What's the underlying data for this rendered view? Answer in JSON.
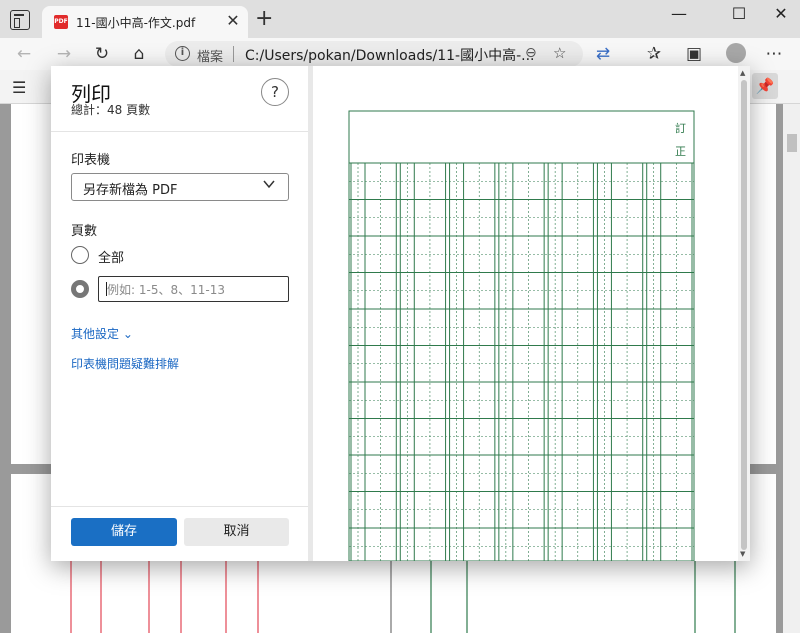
{
  "tab": {
    "title": "11-國小中高-作文.pdf",
    "icon_text": "PDF"
  },
  "window": {
    "minimize": "—",
    "maximize": "☐",
    "close": "✕"
  },
  "address": {
    "label": "檔案",
    "url": "C:/Users/pokan/Downloads/11-國小中高-..."
  },
  "dialog": {
    "title": "列印",
    "subtitle": "總計：48 頁數",
    "help": "?",
    "printer_label": "印表機",
    "printer_value": "另存新檔為 PDF",
    "pages_label": "頁數",
    "all_label": "全部",
    "range_placeholder": "例如: 1-5、8、11-13",
    "more_settings": "其他設定 ⌄",
    "troubleshoot": "印表機問題疑難排解",
    "save": "儲存",
    "cancel": "取消"
  },
  "preview": {
    "mark_1": "訂",
    "mark_2": "正"
  },
  "colors": {
    "grid": "#2f7a4c",
    "accent": "#1a6fc4",
    "link": "#1a67c3"
  }
}
